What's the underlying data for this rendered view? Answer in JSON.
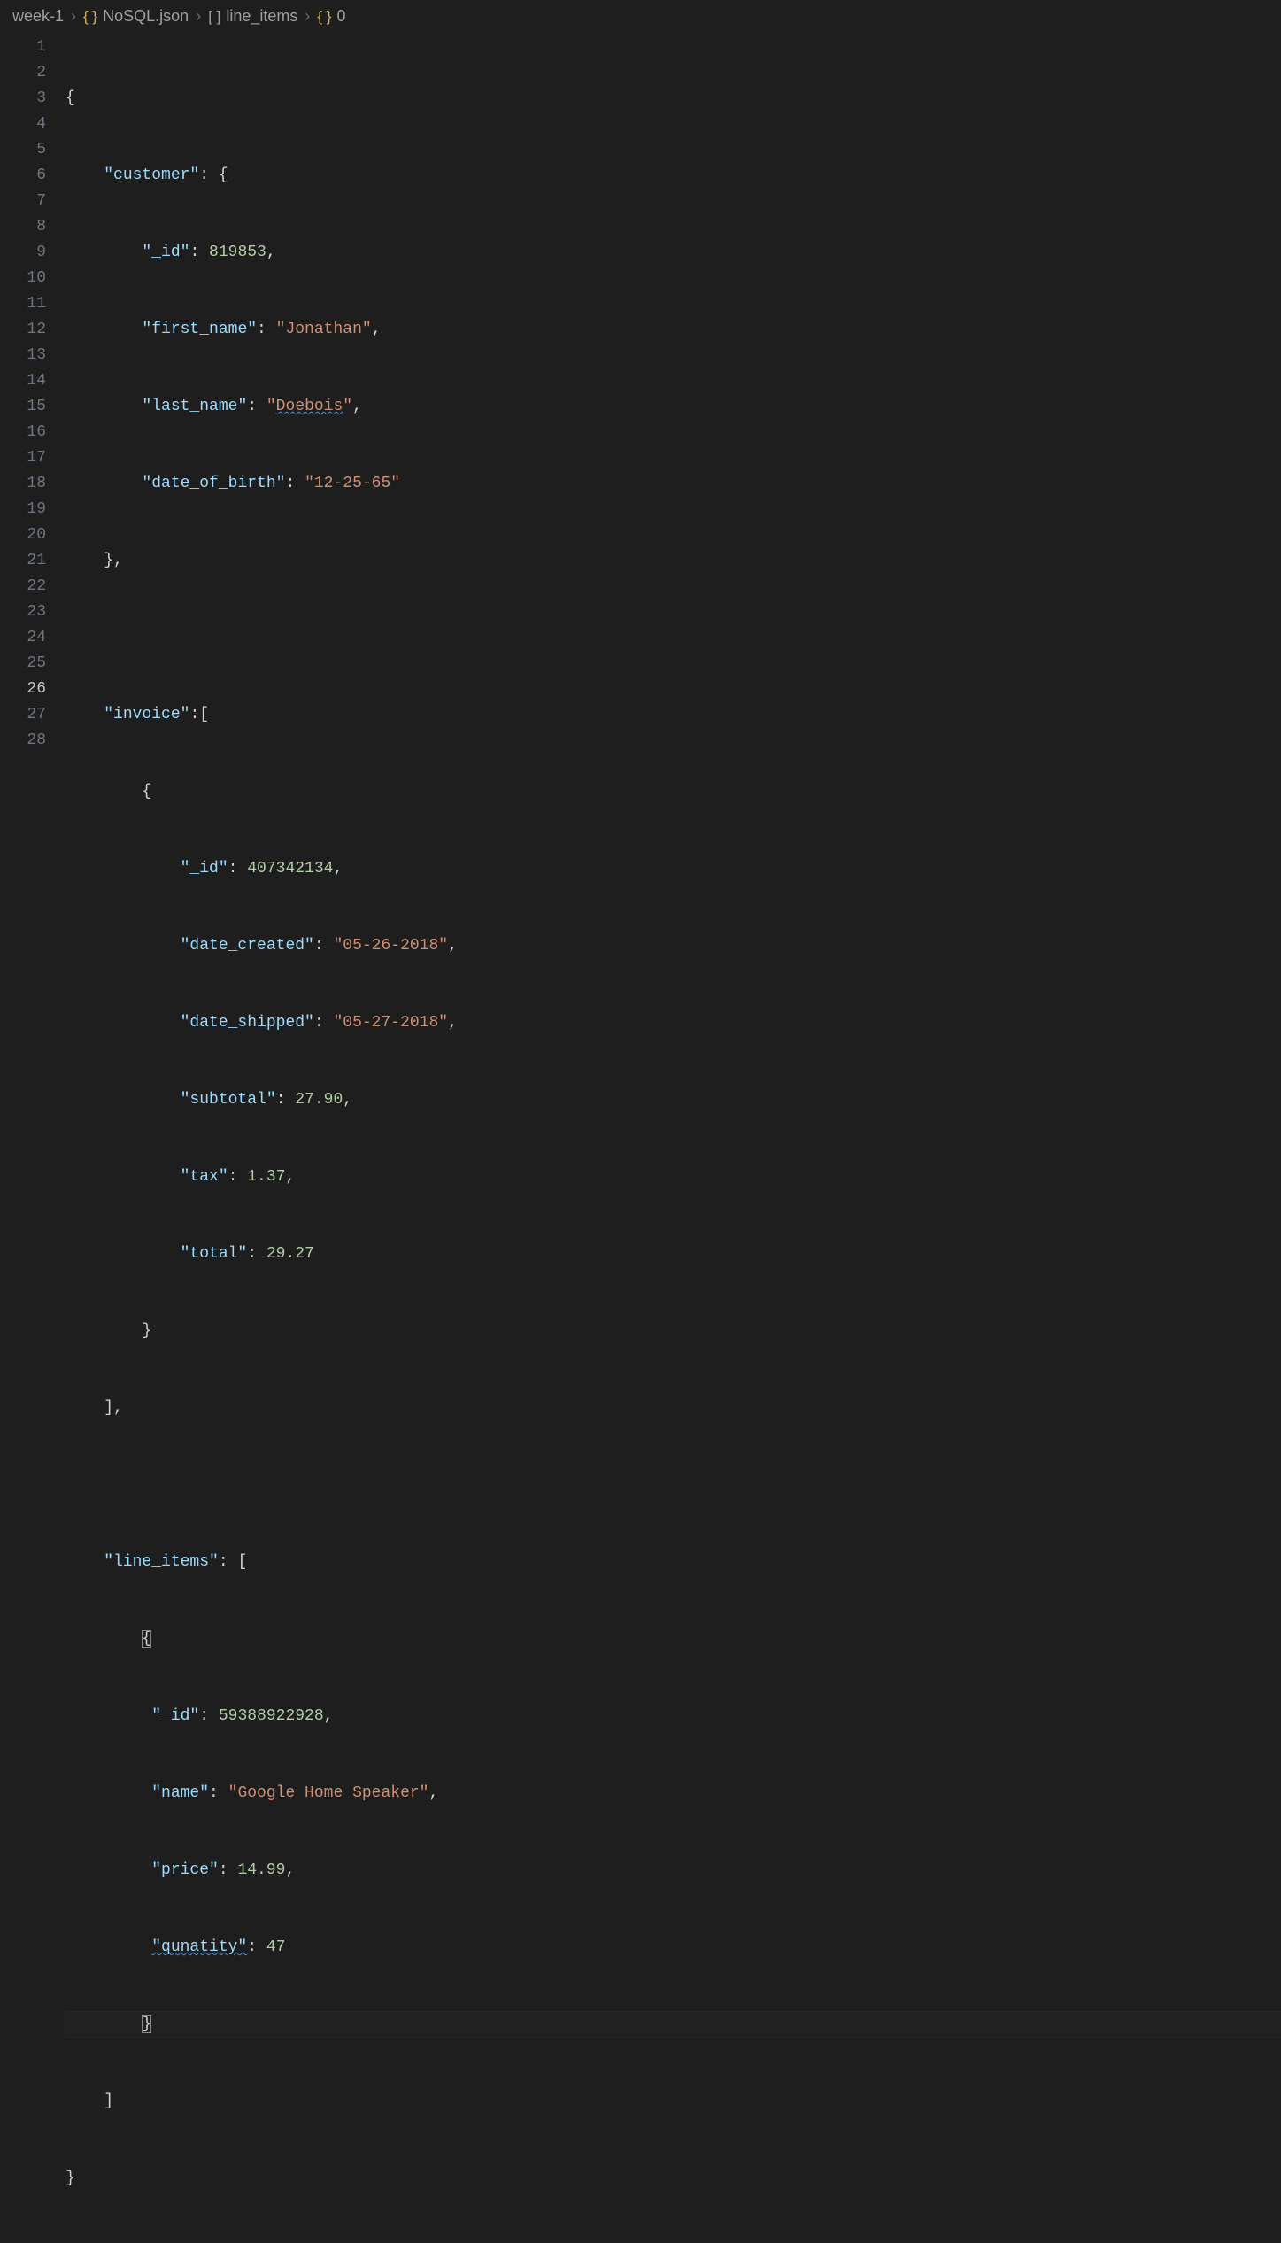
{
  "breadcrumb": {
    "items": [
      {
        "icon": "",
        "label": "week-1"
      },
      {
        "icon": "{ }",
        "iconClass": "ic-braces",
        "label": "NoSQL.json"
      },
      {
        "icon": "[  ]",
        "iconClass": "ic-brackets",
        "label": "line_items"
      },
      {
        "icon": "{ }",
        "iconClass": "ic-braces",
        "label": "0"
      }
    ],
    "separator": "›"
  },
  "line_numbers": [
    "1",
    "2",
    "3",
    "4",
    "5",
    "6",
    "7",
    "8",
    "9",
    "10",
    "11",
    "12",
    "13",
    "14",
    "15",
    "16",
    "17",
    "18",
    "19",
    "20",
    "21",
    "22",
    "23",
    "24",
    "25",
    "26",
    "27",
    "28"
  ],
  "active_line_index": 25,
  "code": {
    "l1": {
      "t0": "{"
    },
    "l2": {
      "k": "\"customer\"",
      "t": ": {"
    },
    "l3": {
      "k": "\"_id\"",
      "c": ": ",
      "v": "819853",
      "t": ","
    },
    "l4": {
      "k": "\"first_name\"",
      "c": ": ",
      "v": "\"Jonathan\"",
      "t": ","
    },
    "l5": {
      "k": "\"last_name\"",
      "c": ": ",
      "q1": "\"",
      "v": "Doebois",
      "q2": "\"",
      "t": ","
    },
    "l6": {
      "k": "\"date_of_birth\"",
      "c": ": ",
      "v": "\"12-25-65\""
    },
    "l7": {
      "t": "},"
    },
    "l9": {
      "k": "\"invoice\"",
      "t": ":["
    },
    "l10": {
      "t": "{"
    },
    "l11": {
      "k": "\"_id\"",
      "c": ": ",
      "v": "407342134",
      "t": ","
    },
    "l12": {
      "k": "\"date_created\"",
      "c": ": ",
      "v": "\"05-26-2018\"",
      "t": ","
    },
    "l13": {
      "k": "\"date_shipped\"",
      "c": ": ",
      "v": "\"05-27-2018\"",
      "t": ","
    },
    "l14": {
      "k": "\"subtotal\"",
      "c": ": ",
      "v": "27.90",
      "t": ","
    },
    "l15": {
      "k": "\"tax\"",
      "c": ": ",
      "v": "1.37",
      "t": ","
    },
    "l16": {
      "k": "\"total\"",
      "c": ": ",
      "v": "29.27"
    },
    "l17": {
      "t": "}"
    },
    "l18": {
      "t": "],"
    },
    "l20": {
      "k": "\"line_items\"",
      "c": ": ",
      "t": "["
    },
    "l21": {
      "t": "{"
    },
    "l22": {
      "k": "\"_id\"",
      "c": ": ",
      "v": "59388922928",
      "t": ","
    },
    "l23": {
      "k": "\"name\"",
      "c": ": ",
      "v": "\"Google Home Speaker\"",
      "t": ","
    },
    "l24": {
      "k": "\"price\"",
      "c": ": ",
      "v": "14.99",
      "t": ","
    },
    "l25": {
      "k": "\"qunatity\"",
      "c": ": ",
      "v": "47"
    },
    "l26": {
      "t": "}"
    },
    "l27": {
      "t": "]"
    },
    "l28": {
      "t": "}"
    }
  }
}
